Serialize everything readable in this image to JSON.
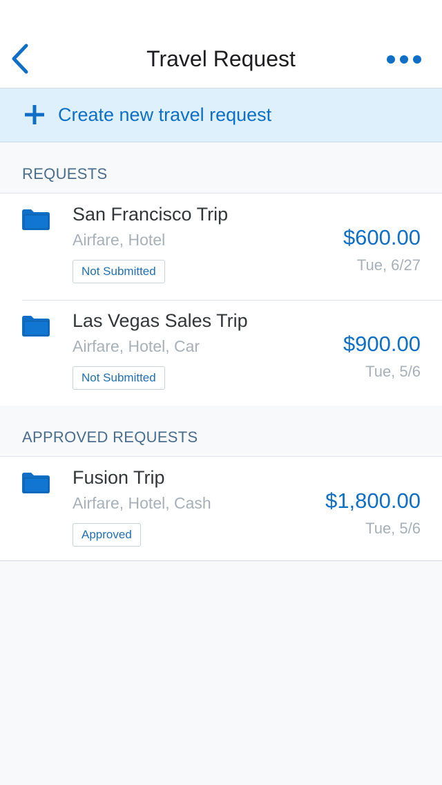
{
  "nav": {
    "title": "Travel Request",
    "back_icon": "chevron-left-icon",
    "more_icon": "ellipsis-icon"
  },
  "create": {
    "label": "Create new travel request",
    "icon": "plus-icon"
  },
  "sections": {
    "requests": {
      "header": "REQUESTS",
      "items": [
        {
          "title": "San Francisco Trip",
          "subtitle": "Airfare, Hotel",
          "status": "Not Submitted",
          "amount": "$600.00",
          "date": "Tue, 6/27",
          "icon": "folder-icon"
        },
        {
          "title": "Las Vegas Sales Trip",
          "subtitle": "Airfare, Hotel, Car",
          "status": "Not Submitted",
          "amount": "$900.00",
          "date": "Tue, 5/6",
          "icon": "folder-icon"
        }
      ]
    },
    "approved": {
      "header": "APPROVED REQUESTS",
      "items": [
        {
          "title": "Fusion Trip",
          "subtitle": "Airfare, Hotel, Cash",
          "status": "Approved",
          "amount": "$1,800.00",
          "date": "Tue, 5/6",
          "icon": "folder-icon"
        }
      ]
    }
  },
  "colors": {
    "accent": "#0f6fc6",
    "create_bar_bg": "#ddf0fc",
    "section_header_text": "#4a6d8c",
    "muted_text": "#a7b0b8"
  }
}
